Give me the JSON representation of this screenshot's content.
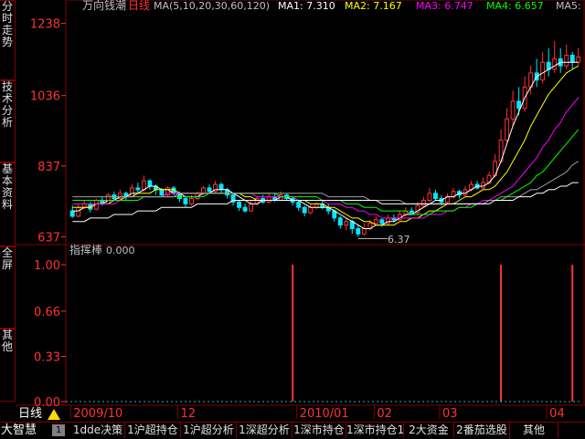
{
  "sidebar": {
    "tabs": [
      {
        "id": "fenshi",
        "label": "分时走势"
      },
      {
        "id": "jishu",
        "label": "技术分析"
      },
      {
        "id": "jiben",
        "label": "基本资料"
      },
      {
        "id": "quanping",
        "label": "全屏"
      },
      {
        "id": "qita",
        "label": "其他"
      }
    ]
  },
  "header": {
    "stock_name": "万向钱潮",
    "period": "日线",
    "ma_params": "MA(5,10,20,30,60,120)",
    "ma1": "MA1: 7.310",
    "ma2": "MA2: 7.167",
    "ma3": "MA3: 6.747",
    "ma4": "MA4: 6.657",
    "ma5": "MA5:"
  },
  "colors": {
    "up": "#ff3232",
    "down": "#00e8ff",
    "ma1": "#ffffff",
    "ma2": "#ffff00",
    "ma3": "#ff00ff",
    "ma4": "#00ff00",
    "ma5": "#a0a0a0",
    "ma6": "#ffffff",
    "border": "#800000",
    "axis_label": "#ff3232"
  },
  "chart_data": [
    {
      "type": "candlestick",
      "price_axis_labels": [
        "1238",
        "1036",
        "837",
        "637"
      ],
      "ylim": [
        6.2,
        12.7
      ],
      "low_annotation": "6.37",
      "x_labels": [
        "2009/10",
        "12",
        "2010/01",
        "02",
        "03",
        "04"
      ],
      "candles": [
        [
          7.1,
          6.95,
          7.25,
          6.9
        ],
        [
          6.95,
          7.2,
          7.3,
          6.92
        ],
        [
          7.2,
          7.3,
          7.4,
          7.15
        ],
        [
          7.3,
          7.15,
          7.35,
          7.05
        ],
        [
          7.15,
          7.4,
          7.45,
          7.12
        ],
        [
          7.4,
          7.3,
          7.5,
          7.25
        ],
        [
          7.3,
          7.55,
          7.6,
          7.28
        ],
        [
          7.55,
          7.45,
          7.65,
          7.4
        ],
        [
          7.45,
          7.6,
          7.7,
          7.42
        ],
        [
          7.6,
          7.5,
          7.65,
          7.4
        ],
        [
          7.5,
          7.75,
          7.85,
          7.48
        ],
        [
          7.75,
          7.7,
          7.9,
          7.6
        ],
        [
          7.7,
          7.95,
          8.1,
          7.65
        ],
        [
          7.95,
          7.8,
          8.0,
          7.7
        ],
        [
          7.8,
          7.7,
          7.85,
          7.55
        ],
        [
          7.7,
          7.55,
          7.75,
          7.5
        ],
        [
          7.55,
          7.75,
          7.8,
          7.5
        ],
        [
          7.75,
          7.6,
          7.8,
          7.55
        ],
        [
          7.6,
          7.45,
          7.65,
          7.35
        ],
        [
          7.45,
          7.3,
          7.5,
          7.2
        ],
        [
          7.3,
          7.45,
          7.55,
          7.25
        ],
        [
          7.45,
          7.6,
          7.65,
          7.4
        ],
        [
          7.6,
          7.75,
          7.8,
          7.55
        ],
        [
          7.75,
          7.65,
          7.85,
          7.6
        ],
        [
          7.65,
          7.85,
          7.95,
          7.62
        ],
        [
          7.85,
          7.7,
          7.9,
          7.6
        ],
        [
          7.7,
          7.55,
          7.75,
          7.45
        ],
        [
          7.55,
          7.35,
          7.6,
          7.25
        ],
        [
          7.35,
          7.2,
          7.4,
          7.1
        ],
        [
          7.2,
          7.1,
          7.3,
          7.05
        ],
        [
          7.1,
          7.3,
          7.4,
          7.08
        ],
        [
          7.3,
          7.45,
          7.5,
          7.25
        ],
        [
          7.45,
          7.35,
          7.55,
          7.3
        ],
        [
          7.35,
          7.5,
          7.6,
          7.32
        ],
        [
          7.5,
          7.4,
          7.6,
          7.35
        ],
        [
          7.4,
          7.55,
          7.65,
          7.38
        ],
        [
          7.55,
          7.45,
          7.6,
          7.4
        ],
        [
          7.45,
          7.35,
          7.5,
          7.25
        ],
        [
          7.35,
          7.2,
          7.4,
          7.1
        ],
        [
          7.2,
          7.05,
          7.25,
          6.95
        ],
        [
          7.05,
          7.2,
          7.3,
          7.0
        ],
        [
          7.2,
          7.3,
          7.35,
          7.15
        ],
        [
          7.3,
          7.2,
          7.4,
          7.15
        ],
        [
          7.2,
          7.1,
          7.3,
          7.0
        ],
        [
          7.1,
          6.9,
          7.15,
          6.8
        ],
        [
          6.9,
          6.7,
          6.95,
          6.6
        ],
        [
          6.7,
          6.8,
          6.9,
          6.55
        ],
        [
          6.8,
          6.6,
          6.85,
          6.45
        ],
        [
          6.6,
          6.45,
          6.7,
          6.37
        ],
        [
          6.45,
          6.6,
          6.75,
          6.4
        ],
        [
          6.6,
          6.75,
          6.85,
          6.55
        ],
        [
          6.75,
          6.85,
          6.95,
          6.7
        ],
        [
          6.85,
          6.75,
          6.9,
          6.65
        ],
        [
          6.75,
          6.9,
          7.0,
          6.7
        ],
        [
          6.9,
          6.85,
          7.0,
          6.8
        ],
        [
          6.85,
          7.0,
          7.1,
          6.82
        ],
        [
          7.0,
          7.1,
          7.2,
          6.95
        ],
        [
          7.1,
          7.05,
          7.2,
          7.0
        ],
        [
          7.05,
          7.25,
          7.35,
          7.02
        ],
        [
          7.25,
          7.4,
          7.5,
          7.2
        ],
        [
          7.4,
          7.6,
          7.75,
          7.35
        ],
        [
          7.6,
          7.45,
          7.7,
          7.4
        ],
        [
          7.45,
          7.35,
          7.55,
          7.25
        ],
        [
          7.35,
          7.5,
          7.6,
          7.3
        ],
        [
          7.5,
          7.65,
          7.75,
          7.45
        ],
        [
          7.65,
          7.55,
          7.7,
          7.45
        ],
        [
          7.55,
          7.7,
          7.8,
          7.5
        ],
        [
          7.7,
          7.85,
          7.95,
          7.65
        ],
        [
          7.85,
          7.75,
          7.95,
          7.7
        ],
        [
          7.75,
          7.9,
          8.05,
          7.7
        ],
        [
          7.9,
          8.1,
          8.2,
          7.85
        ],
        [
          8.1,
          8.5,
          8.7,
          8.05
        ],
        [
          8.5,
          9.1,
          9.4,
          8.45
        ],
        [
          9.1,
          9.7,
          10.0,
          9.05
        ],
        [
          9.7,
          10.2,
          10.5,
          9.5
        ],
        [
          10.2,
          10.0,
          10.6,
          9.8
        ],
        [
          10.0,
          10.6,
          10.9,
          9.9
        ],
        [
          10.6,
          11.0,
          11.2,
          10.4
        ],
        [
          11.0,
          10.8,
          11.4,
          10.6
        ],
        [
          10.8,
          11.3,
          11.6,
          10.7
        ],
        [
          11.3,
          11.1,
          11.7,
          10.9
        ],
        [
          11.1,
          11.4,
          11.9,
          11.0
        ],
        [
          11.4,
          11.2,
          11.7,
          11.0
        ],
        [
          11.2,
          11.5,
          11.8,
          11.1
        ],
        [
          11.5,
          11.3,
          11.6,
          11.1
        ],
        [
          11.3,
          11.45,
          11.7,
          11.2
        ]
      ],
      "ma": [
        {
          "name": "MA1",
          "values": [
            7.1,
            7.1,
            7.2,
            7.2,
            7.3,
            7.3,
            7.4,
            7.4,
            7.5,
            7.5,
            7.6,
            7.6,
            7.7,
            7.8,
            7.8,
            7.7,
            7.7,
            7.6,
            7.6,
            7.5,
            7.5,
            7.5,
            7.6,
            7.6,
            7.7,
            7.7,
            7.7,
            7.6,
            7.5,
            7.4,
            7.3,
            7.3,
            7.4,
            7.4,
            7.4,
            7.5,
            7.5,
            7.4,
            7.4,
            7.3,
            7.2,
            7.2,
            7.2,
            7.2,
            7.1,
            7.0,
            6.9,
            6.8,
            6.7,
            6.6,
            6.6,
            6.7,
            6.7,
            6.8,
            6.8,
            6.9,
            7.0,
            7.0,
            7.1,
            7.2,
            7.3,
            7.4,
            7.4,
            7.5,
            7.5,
            7.6,
            7.6,
            7.7,
            7.8,
            7.8,
            7.9,
            8.1,
            8.5,
            9.0,
            9.5,
            9.9,
            10.3,
            10.6,
            10.9,
            11.0,
            11.1,
            11.2,
            11.3,
            11.3,
            11.3,
            11.3
          ]
        },
        {
          "name": "MA2",
          "values": [
            7.2,
            7.2,
            7.2,
            7.2,
            7.3,
            7.3,
            7.3,
            7.4,
            7.4,
            7.5,
            7.5,
            7.6,
            7.6,
            7.6,
            7.7,
            7.7,
            7.7,
            7.7,
            7.6,
            7.6,
            7.6,
            7.6,
            7.6,
            7.6,
            7.6,
            7.6,
            7.6,
            7.6,
            7.6,
            7.5,
            7.5,
            7.4,
            7.4,
            7.4,
            7.4,
            7.4,
            7.4,
            7.4,
            7.4,
            7.4,
            7.3,
            7.3,
            7.3,
            7.2,
            7.2,
            7.1,
            7.0,
            6.9,
            6.9,
            6.8,
            6.8,
            6.7,
            6.7,
            6.7,
            6.7,
            6.8,
            6.8,
            6.9,
            6.9,
            7.0,
            7.1,
            7.1,
            7.2,
            7.3,
            7.3,
            7.4,
            7.5,
            7.5,
            7.6,
            7.7,
            7.7,
            7.8,
            8.0,
            8.2,
            8.5,
            8.8,
            9.1,
            9.5,
            9.8,
            10.1,
            10.4,
            10.6,
            10.8,
            11.0,
            11.1,
            11.2
          ]
        },
        {
          "name": "MA3",
          "values": [
            7.3,
            7.3,
            7.3,
            7.3,
            7.3,
            7.3,
            7.3,
            7.3,
            7.4,
            7.4,
            7.4,
            7.4,
            7.5,
            7.5,
            7.5,
            7.5,
            7.6,
            7.6,
            7.6,
            7.6,
            7.6,
            7.6,
            7.6,
            7.6,
            7.6,
            7.6,
            7.6,
            7.6,
            7.6,
            7.6,
            7.6,
            7.5,
            7.5,
            7.5,
            7.5,
            7.5,
            7.5,
            7.5,
            7.4,
            7.4,
            7.4,
            7.4,
            7.4,
            7.3,
            7.3,
            7.3,
            7.2,
            7.2,
            7.1,
            7.1,
            7.0,
            7.0,
            6.9,
            6.9,
            6.9,
            6.9,
            6.9,
            6.9,
            6.9,
            6.9,
            7.0,
            7.0,
            7.0,
            7.1,
            7.1,
            7.2,
            7.2,
            7.3,
            7.3,
            7.4,
            7.4,
            7.5,
            7.6,
            7.7,
            7.8,
            8.0,
            8.2,
            8.4,
            8.6,
            8.9,
            9.1,
            9.4,
            9.6,
            9.9,
            10.1,
            10.3
          ]
        },
        {
          "name": "MA4",
          "values": [
            7.4,
            7.4,
            7.4,
            7.4,
            7.4,
            7.4,
            7.4,
            7.4,
            7.4,
            7.4,
            7.4,
            7.4,
            7.5,
            7.5,
            7.5,
            7.5,
            7.5,
            7.5,
            7.5,
            7.5,
            7.5,
            7.5,
            7.5,
            7.6,
            7.6,
            7.6,
            7.6,
            7.6,
            7.6,
            7.6,
            7.6,
            7.6,
            7.6,
            7.6,
            7.6,
            7.5,
            7.5,
            7.5,
            7.5,
            7.5,
            7.5,
            7.5,
            7.4,
            7.4,
            7.4,
            7.4,
            7.3,
            7.3,
            7.3,
            7.2,
            7.2,
            7.2,
            7.1,
            7.1,
            7.1,
            7.1,
            7.1,
            7.0,
            7.0,
            7.0,
            7.0,
            7.1,
            7.1,
            7.1,
            7.1,
            7.2,
            7.2,
            7.2,
            7.3,
            7.3,
            7.4,
            7.4,
            7.5,
            7.5,
            7.6,
            7.7,
            7.8,
            7.9,
            8.1,
            8.2,
            8.4,
            8.6,
            8.8,
            9.0,
            9.2,
            9.4
          ]
        },
        {
          "name": "MA5",
          "values": [
            7.5,
            7.5,
            7.5,
            7.5,
            7.5,
            7.5,
            7.5,
            7.5,
            7.5,
            7.5,
            7.5,
            7.5,
            7.5,
            7.5,
            7.5,
            7.5,
            7.5,
            7.5,
            7.6,
            7.6,
            7.6,
            7.6,
            7.6,
            7.6,
            7.6,
            7.6,
            7.6,
            7.6,
            7.6,
            7.6,
            7.6,
            7.6,
            7.6,
            7.6,
            7.6,
            7.6,
            7.6,
            7.6,
            7.6,
            7.6,
            7.6,
            7.6,
            7.6,
            7.5,
            7.5,
            7.5,
            7.5,
            7.5,
            7.5,
            7.5,
            7.4,
            7.4,
            7.4,
            7.4,
            7.4,
            7.4,
            7.3,
            7.3,
            7.3,
            7.3,
            7.3,
            7.3,
            7.3,
            7.3,
            7.3,
            7.3,
            7.3,
            7.3,
            7.3,
            7.3,
            7.4,
            7.4,
            7.4,
            7.5,
            7.5,
            7.5,
            7.6,
            7.7,
            7.7,
            7.8,
            7.9,
            8.0,
            8.1,
            8.2,
            8.4,
            8.5
          ]
        },
        {
          "name": "MA6",
          "values": [
            6.8,
            6.8,
            6.8,
            6.9,
            6.9,
            6.9,
            6.9,
            7.0,
            7.0,
            7.0,
            7.0,
            7.1,
            7.1,
            7.1,
            7.1,
            7.2,
            7.2,
            7.2,
            7.2,
            7.2,
            7.2,
            7.3,
            7.3,
            7.3,
            7.3,
            7.3,
            7.3,
            7.4,
            7.4,
            7.4,
            7.4,
            7.4,
            7.4,
            7.4,
            7.4,
            7.4,
            7.4,
            7.4,
            7.4,
            7.4,
            7.4,
            7.4,
            7.4,
            7.4,
            7.4,
            7.4,
            7.4,
            7.4,
            7.4,
            7.4,
            7.4,
            7.4,
            7.3,
            7.3,
            7.3,
            7.3,
            7.3,
            7.3,
            7.3,
            7.3,
            7.3,
            7.3,
            7.3,
            7.3,
            7.3,
            7.3,
            7.3,
            7.3,
            7.3,
            7.3,
            7.3,
            7.4,
            7.4,
            7.4,
            7.4,
            7.5,
            7.5,
            7.5,
            7.6,
            7.6,
            7.7,
            7.7,
            7.8,
            7.8,
            7.9,
            7.9
          ]
        }
      ]
    },
    {
      "type": "bar",
      "title": "指挥棒",
      "current_value": "0.000",
      "y_axis_labels": [
        "1.00",
        "0.66",
        "0.33",
        "0.00"
      ],
      "ylim": [
        0,
        1
      ],
      "bars": [
        {
          "index": 37,
          "value": 1.0
        },
        {
          "index": 72,
          "value": 1.0
        },
        {
          "index": 84,
          "value": 1.0
        }
      ]
    }
  ],
  "bottombar": {
    "brand": "大智慧",
    "badge": "1",
    "period_label": "日线",
    "tabs": [
      {
        "label": "1dde决策"
      },
      {
        "label": "1沪超持仓"
      },
      {
        "label": "1沪超分析"
      },
      {
        "label": "1深超分析"
      },
      {
        "label": "1深市持仓"
      },
      {
        "label": "1深市持仓1"
      },
      {
        "label": "2大资金"
      },
      {
        "label": "2番茄选股"
      },
      {
        "label": "其他"
      }
    ]
  }
}
